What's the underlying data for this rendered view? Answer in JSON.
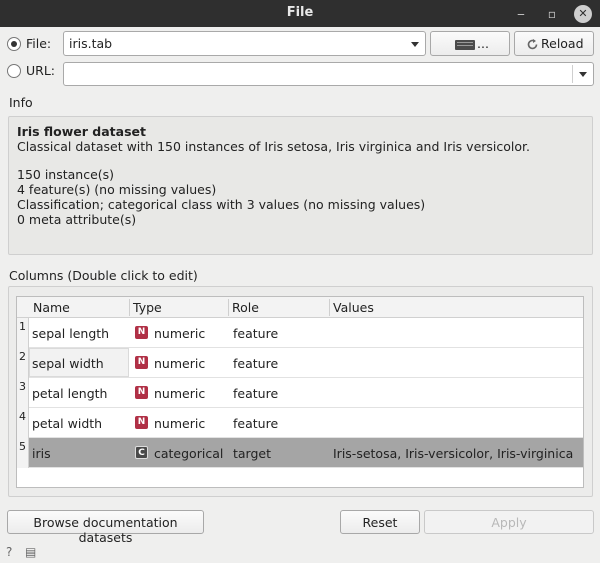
{
  "window": {
    "title": "File",
    "minimize_glyph": "‒",
    "maximize_glyph": "▫",
    "close_glyph": "✕"
  },
  "source": {
    "file_label": "File:",
    "file_value": "iris.tab",
    "browse_label": "...",
    "reload_label": "Reload",
    "url_label": "URL:",
    "url_value": ""
  },
  "info": {
    "section_label": "Info",
    "dataset_title": "Iris flower dataset",
    "dataset_description": "Classical dataset with 150 instances of Iris setosa, Iris virginica and Iris versicolor.",
    "instances": "150 instance(s)",
    "features": "4 feature(s) (no missing values)",
    "classification": "Classification; categorical class with 3 values (no missing values)",
    "meta": "0 meta attribute(s)"
  },
  "columns": {
    "section_label": "Columns (Double click to edit)",
    "headers": {
      "name": "Name",
      "type": "Type",
      "role": "Role",
      "values": "Values"
    },
    "rows": [
      {
        "num": "1",
        "name": "sepal length",
        "type_icon": "N",
        "type": "numeric",
        "role": "feature",
        "values": ""
      },
      {
        "num": "2",
        "name": "sepal width",
        "type_icon": "N",
        "type": "numeric",
        "role": "feature",
        "values": ""
      },
      {
        "num": "3",
        "name": "petal length",
        "type_icon": "N",
        "type": "numeric",
        "role": "feature",
        "values": ""
      },
      {
        "num": "4",
        "name": "petal width",
        "type_icon": "N",
        "type": "numeric",
        "role": "feature",
        "values": ""
      },
      {
        "num": "5",
        "name": "iris",
        "type_icon": "C",
        "type": "categorical",
        "role": "target",
        "values": "Iris-setosa, Iris-versicolor, Iris-virginica"
      }
    ]
  },
  "actions": {
    "browse_docs_label": "Browse documentation datasets",
    "reset_label": "Reset",
    "apply_label": "Apply"
  },
  "status": {
    "help_glyph": "?",
    "report_glyph": "▤"
  },
  "icons": {
    "folder": "folder-icon",
    "reload": "reload-icon",
    "help": "help-icon",
    "report": "report-icon"
  },
  "colors": {
    "numeric_badge": "#b03046",
    "selected_row": "#a5a5a5",
    "titlebar": "#2f2f2f"
  }
}
